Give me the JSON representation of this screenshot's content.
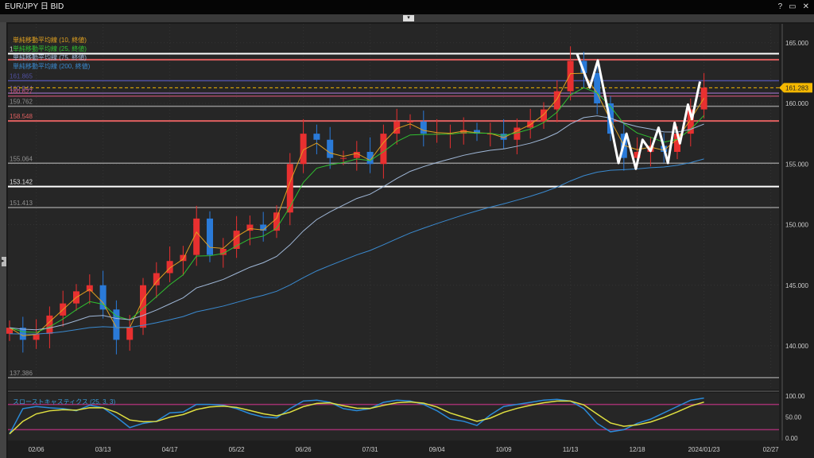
{
  "window": {
    "title": "EUR/JPY 日 BID",
    "help": "?",
    "maximize": "▭",
    "close": "✕",
    "collapse": "▾",
    "side_handle": "▸"
  },
  "chart_data": {
    "type": "candlestick",
    "title": "EUR/JPY 日 BID",
    "ylim": [
      136,
      166.5
    ],
    "y_ticks": [
      "165.000",
      "160.000",
      "155.000",
      "150.000",
      "145.000",
      "140.000"
    ],
    "y_tick_values": [
      165,
      160,
      155,
      150,
      145,
      140
    ],
    "x_ticks": [
      "02/06",
      "03/13",
      "04/17",
      "05/22",
      "06/26",
      "07/31",
      "09/04",
      "10/09",
      "11/13",
      "12/18",
      "2024/01/23",
      "02/27"
    ],
    "x_tick_index": [
      2,
      7,
      12,
      17,
      22,
      27,
      32,
      37,
      42,
      47,
      52,
      57
    ],
    "closes": [
      141.5,
      140.5,
      141,
      142.5,
      143.5,
      144.5,
      145,
      143,
      140.5,
      141.5,
      145,
      146,
      147,
      147.5,
      150.5,
      147.5,
      148,
      149.5,
      150,
      149.5,
      151,
      155,
      157.5,
      157,
      155.5,
      155.5,
      156,
      155,
      157.5,
      158.5,
      158.5,
      157.5,
      157.5,
      157.5,
      157.8,
      157.5,
      157.5,
      157,
      158,
      158.5,
      159.5,
      161,
      163.5,
      162.5,
      160,
      157.5,
      155.5,
      156,
      156.5,
      156,
      157.5,
      159.5,
      161.3
    ],
    "open_first": 141,
    "current_price": {
      "label": "161.283",
      "value": 161.283,
      "color": "#f5b800"
    },
    "legend": [
      {
        "name": "単純移動平均線 (10, 終値)",
        "color": "#e0a020",
        "span": 2
      },
      {
        "name": "単純移動平均線 (25, 終値)",
        "color": "#30c030",
        "span": 5
      },
      {
        "name": "単純移動平均線 (75, 終値)",
        "color": "#a0b8d8",
        "span": 15
      },
      {
        "name": "単純移動平均線 (200, 終値)",
        "color": "#3a8ad0",
        "span": 40
      }
    ],
    "levels": [
      {
        "label": "1",
        "value": 164.1,
        "color": "#ffffff",
        "width": 2
      },
      {
        "label": "",
        "value": 163.6,
        "color": "#e06060",
        "width": 2
      },
      {
        "label": "161.865",
        "value": 161.865,
        "color": "#5050a0",
        "width": 1.5
      },
      {
        "label": "160.844",
        "value": 160.844,
        "color": "#8060a0",
        "width": 1.5
      },
      {
        "label": "160.627",
        "value": 160.6,
        "color": "#c05070",
        "width": 1.2
      },
      {
        "label": "159.762",
        "value": 159.762,
        "color": "#909090",
        "width": 1.5
      },
      {
        "label": "158.548",
        "value": 158.548,
        "color": "#e06060",
        "width": 2
      },
      {
        "label": "155.064",
        "value": 155.064,
        "color": "#909090",
        "width": 1.5
      },
      {
        "label": "153.142",
        "value": 153.142,
        "color": "#ffffff",
        "width": 2
      },
      {
        "label": "151.413",
        "value": 151.413,
        "color": "#909090",
        "width": 1.5
      },
      {
        "label": "137.386",
        "value": 137.386,
        "color": "#909090",
        "width": 1.5
      }
    ],
    "zigzag": [
      [
        42.5,
        164.07
      ],
      [
        43.45,
        161.31
      ],
      [
        44.05,
        163.54
      ],
      [
        45.6,
        155.08
      ],
      [
        46.2,
        157.5
      ],
      [
        46.9,
        154.6
      ],
      [
        47.4,
        157.0
      ],
      [
        48,
        156.07
      ],
      [
        48.6,
        158.0
      ],
      [
        49.3,
        155.08
      ],
      [
        49.8,
        158.4
      ],
      [
        50.2,
        156.7
      ],
      [
        50.8,
        159.9
      ],
      [
        51.1,
        158.7
      ],
      [
        51.7,
        161.8
      ]
    ],
    "stochastic": {
      "title": "スローストキャスティクス (25, 3, 3)",
      "y_ticks": [
        "100.00",
        "50.00",
        "0.00"
      ],
      "y_tick_values": [
        100,
        50,
        0
      ],
      "levels": [
        80,
        20
      ],
      "k": [
        10,
        70,
        75,
        72,
        70,
        65,
        78,
        72,
        50,
        25,
        35,
        40,
        60,
        62,
        80,
        80,
        78,
        70,
        58,
        50,
        48,
        70,
        88,
        90,
        85,
        70,
        65,
        70,
        85,
        90,
        88,
        80,
        65,
        45,
        40,
        30,
        55,
        75,
        80,
        85,
        90,
        92,
        88,
        70,
        35,
        15,
        20,
        35,
        45,
        60,
        75,
        90,
        95
      ]
    },
    "colors": {
      "up": "#e83030",
      "down": "#2a7ad8",
      "bg": "#262626",
      "grid": "#333333"
    }
  }
}
